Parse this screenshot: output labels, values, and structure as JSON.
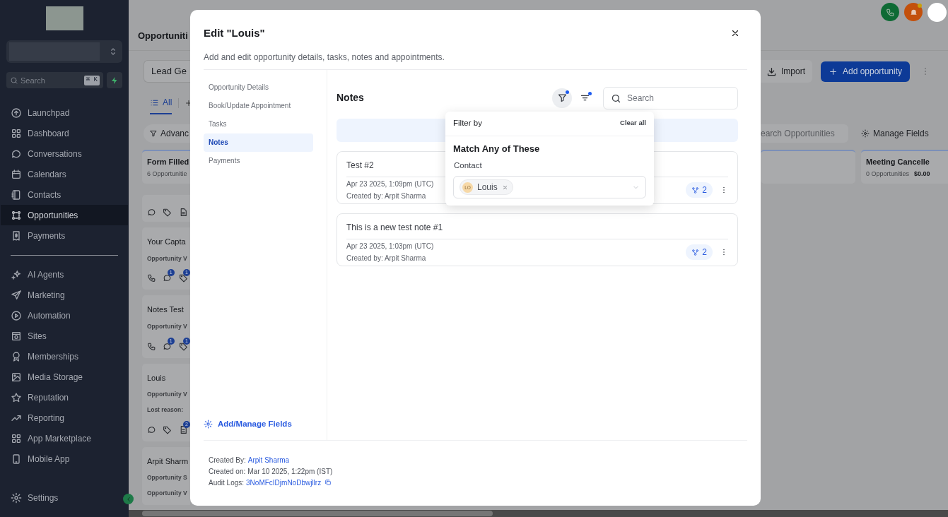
{
  "sidebar": {
    "search": {
      "placeholder": "Search",
      "shortcut": "⌘ K"
    },
    "nav": [
      {
        "label": "Launchpad",
        "selected": false
      },
      {
        "label": "Dashboard",
        "selected": false
      },
      {
        "label": "Conversations",
        "selected": false
      },
      {
        "label": "Calendars",
        "selected": false
      },
      {
        "label": "Contacts",
        "selected": false
      },
      {
        "label": "Opportunities",
        "selected": true
      },
      {
        "label": "Payments",
        "selected": false
      }
    ],
    "nav_secondary": [
      {
        "label": "AI Agents",
        "selected": false
      },
      {
        "label": "Marketing",
        "selected": false
      },
      {
        "label": "Automation",
        "selected": false
      },
      {
        "label": "Sites",
        "selected": false
      },
      {
        "label": "Memberships",
        "selected": false
      },
      {
        "label": "Media Storage",
        "selected": false
      },
      {
        "label": "Reputation",
        "selected": false
      },
      {
        "label": "Reporting",
        "selected": false
      },
      {
        "label": "App Marketplace",
        "selected": false
      },
      {
        "label": "Mobile App",
        "selected": false
      }
    ],
    "settings": "Settings"
  },
  "header": {
    "title": "Opportuniti",
    "notification_dot": true
  },
  "toolbar": {
    "pipeline": "Lead Ge",
    "import": "Import",
    "add": "Add opportunity"
  },
  "view_tabs": [
    {
      "label": "All",
      "selected": true
    }
  ],
  "filters": {
    "advanced": "Advanc",
    "search_placeholder": "earch Opportunities",
    "manage_fields": "Manage Fields"
  },
  "board_left": [
    {
      "kind": "stage",
      "title": "Form Filled",
      "subtitle": "6 Opportunitie"
    },
    {
      "kind": "actions",
      "actions": [
        {
          "kind": "chat"
        },
        {
          "kind": "tag"
        },
        {
          "kind": "note"
        }
      ]
    },
    {
      "kind": "opportunity",
      "title": "Your Capta",
      "lines": [
        "Opportunity V"
      ],
      "actions": [
        {
          "kind": "phone"
        },
        {
          "kind": "chat",
          "badge": "1"
        },
        {
          "kind": "tag",
          "badge": "1"
        }
      ]
    },
    {
      "kind": "opportunity",
      "title": "Notes Test",
      "lines": [
        "Opportunity V"
      ],
      "actions": [
        {
          "kind": "phone"
        },
        {
          "kind": "chat",
          "badge": "1"
        },
        {
          "kind": "tag",
          "badge": "1"
        }
      ]
    },
    {
      "kind": "opportunity",
      "title": "Louis",
      "lines": [
        "Opportunity V",
        "Lost reason:"
      ],
      "actions": [
        {
          "kind": "chat"
        },
        {
          "kind": "tag"
        },
        {
          "kind": "note",
          "badge": "2"
        }
      ]
    },
    {
      "kind": "opportunity",
      "title": "Arpit Sharm",
      "lines": [
        "Opportunity S",
        "Opportunity V"
      ]
    }
  ],
  "board_right": [
    {
      "kind": "stage"
    },
    {
      "kind": "stage",
      "title": "Meeting Cancelle",
      "subtitle": "0 Opportunities",
      "amount": "$0.00"
    }
  ],
  "modal": {
    "title": "Edit \"Louis\"",
    "subtitle": "Add and edit opportunity details, tasks, notes and appointments.",
    "nav": [
      {
        "label": "Opportunity Details",
        "selected": false
      },
      {
        "label": "Book/Update Appointment",
        "selected": false
      },
      {
        "label": "Tasks",
        "selected": false
      },
      {
        "label": "Notes",
        "selected": true
      },
      {
        "label": "Payments",
        "selected": false
      }
    ],
    "manage_fields": "Add/Manage Fields",
    "footer": [
      {
        "label": "Created By:",
        "value": "Arpit Sharma",
        "link": true,
        "copy": false
      },
      {
        "label": "Created on:",
        "value": "Mar 10 2025, 1:22pm (IST)",
        "link": false,
        "copy": false
      },
      {
        "label": "Audit Logs:",
        "value": "3NoMFcIDjmNoDbwjllrz",
        "link": true,
        "copy": true
      }
    ],
    "notes": {
      "heading": "Notes",
      "filter_active": true,
      "sort_active": true,
      "search_placeholder": "Search",
      "items": [
        {
          "text": "Test #2",
          "date": "Apr 23 2025, 1:09pm (UTC)",
          "author": "Created by: Arpit Sharma",
          "links": "2"
        },
        {
          "text": "This is a new test note #1",
          "date": "Apr 23 2025, 1:03pm (UTC)",
          "author": "Created by: Arpit Sharma",
          "links": "2"
        }
      ]
    },
    "filter_popover": {
      "title": "Filter by",
      "clear": "Clear all",
      "heading": "Match Any of These",
      "field_label": "Contact",
      "chips": [
        {
          "initials": "LO",
          "label": "Louis"
        }
      ]
    }
  }
}
